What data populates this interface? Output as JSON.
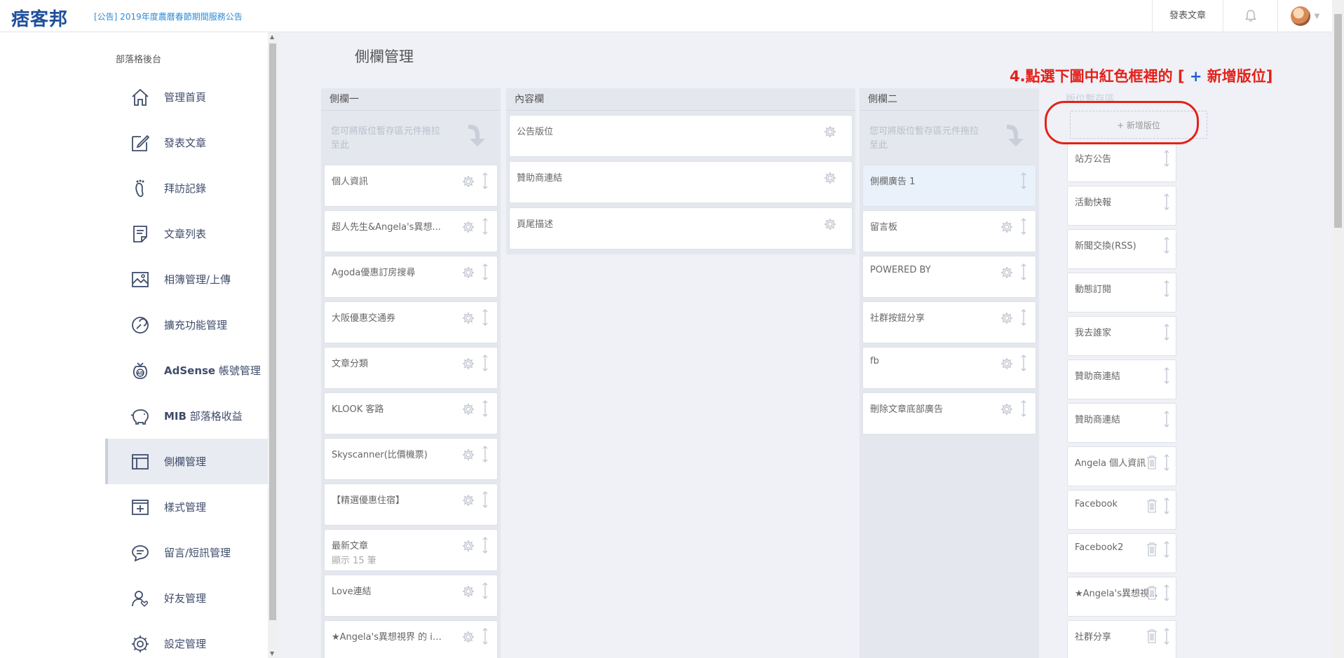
{
  "header": {
    "logo_text": "痞客邦",
    "announcement": "[公告] 2019年度農曆春節期間服務公告",
    "post_article": "發表文章"
  },
  "sidebar": {
    "heading": "部落格後台",
    "items": [
      {
        "label": "管理首頁",
        "icon": "home-icon"
      },
      {
        "label": "發表文章",
        "icon": "edit-icon"
      },
      {
        "label": "拜訪記錄",
        "icon": "footprint-icon"
      },
      {
        "label": "文章列表",
        "icon": "document-list-icon"
      },
      {
        "label": "相簿管理/上傳",
        "icon": "image-icon"
      },
      {
        "label": "擴充功能管理",
        "icon": "extension-icon"
      },
      {
        "prefix": "AdSense",
        "label": " 帳號管理",
        "icon": "adsense-icon"
      },
      {
        "prefix": "MIB",
        "label": " 部落格收益",
        "icon": "piggy-bank-icon"
      },
      {
        "label": "側欄管理",
        "icon": "sidebar-layout-icon",
        "active": true
      },
      {
        "label": "樣式管理",
        "icon": "style-add-icon"
      },
      {
        "label": "留言/短訊管理",
        "icon": "chat-bubble-icon"
      },
      {
        "label": "好友管理",
        "icon": "friend-icon"
      },
      {
        "label": "設定管理",
        "icon": "settings-icon"
      }
    ]
  },
  "main": {
    "title": "側欄管理",
    "instruction": {
      "prefix": "4.點選下圖中紅色框裡的 [ ",
      "plus": "+",
      "suffix": " 新增版位]"
    },
    "drop_hint": "您可將版位暫存區元件拖拉至此",
    "columns": {
      "col1": {
        "title": "側欄一",
        "cards": [
          {
            "name": "個人資訊"
          },
          {
            "name": "超人先生&Angela's異想..."
          },
          {
            "name": "Agoda優惠訂房搜尋"
          },
          {
            "name": "大阪優惠交通券"
          },
          {
            "name": "文章分類"
          },
          {
            "name": "KLOOK 客路"
          },
          {
            "name": "Skyscanner(比價機票)"
          },
          {
            "name": "【精選優惠住宿】"
          },
          {
            "name": "最新文章",
            "sub": "顯示 15 筆"
          },
          {
            "name": "Love連結"
          },
          {
            "name": "★Angela's異想視界 的 in..."
          }
        ]
      },
      "col2": {
        "title": "內容欄",
        "cards": [
          {
            "name": "公告版位"
          },
          {
            "name": "贊助商連結"
          },
          {
            "name": "頁尾描述"
          }
        ]
      },
      "col3": {
        "title": "側欄二",
        "cards": [
          {
            "name": "側欄廣告 1",
            "highlight": true
          },
          {
            "name": "留言板"
          },
          {
            "name": "POWERED BY"
          },
          {
            "name": "社群按鈕分享"
          },
          {
            "name": "fb"
          },
          {
            "name": "刪除文章底部廣告"
          }
        ]
      },
      "col4": {
        "title": "版位暫存區",
        "add_button": "+ 新增版位",
        "cards": [
          {
            "name": "站方公告"
          },
          {
            "name": "活動快報"
          },
          {
            "name": "新聞交換(RSS)"
          },
          {
            "name": "動態訂閱"
          },
          {
            "name": "我去誰家"
          },
          {
            "name": "贊助商連結"
          },
          {
            "name": "贊助商連結"
          },
          {
            "name": "Angela 個人資訊",
            "trash": true
          },
          {
            "name": "Facebook",
            "trash": true
          },
          {
            "name": "Facebook2",
            "trash": true
          },
          {
            "name": "★Angela's異想視...",
            "trash": true
          },
          {
            "name": "社群分享",
            "trash": true
          }
        ]
      }
    }
  },
  "colors": {
    "accent_red": "#e4211a",
    "accent_blue": "#1f5fd8",
    "logo_blue": "#1f4f9c",
    "link_blue": "#2e8bd6"
  }
}
